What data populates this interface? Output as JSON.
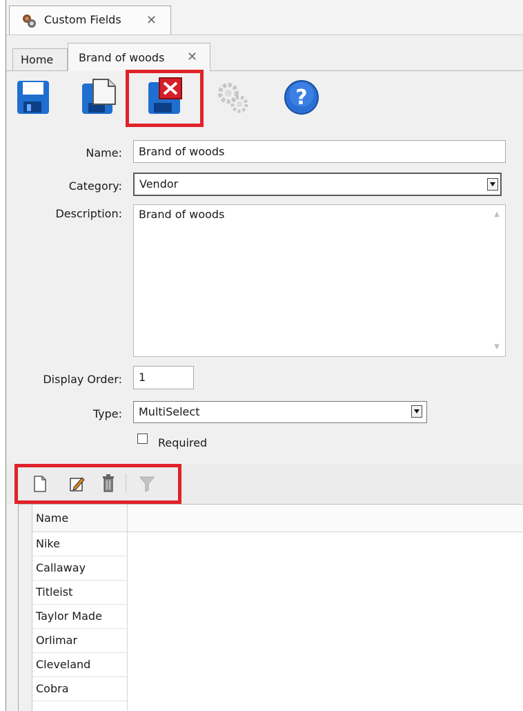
{
  "window_tab": {
    "title": "Custom Fields",
    "close_glyph": "✕",
    "icon": "custom-fields-app-icon"
  },
  "doc_tabs": [
    {
      "label": "Home",
      "selected": false
    },
    {
      "label": "Brand of woods",
      "selected": true,
      "close_glyph": "✕"
    }
  ],
  "toolbar": {
    "buttons": [
      {
        "name": "save-icon"
      },
      {
        "name": "save-as-icon"
      },
      {
        "name": "save-and-close-icon",
        "highlighted": true
      },
      {
        "name": "gears-icon",
        "disabled": true
      },
      {
        "name": "help-icon",
        "glyph": "?"
      }
    ]
  },
  "form": {
    "name_label": "Name:",
    "name_value": "Brand of woods",
    "category_label": "Category:",
    "category_value": "Vendor",
    "description_label": "Description:",
    "description_value": "Brand of woods",
    "display_order_label": "Display Order:",
    "display_order_value": "1",
    "type_label": "Type:",
    "type_value": "MultiSelect",
    "required_label": "Required",
    "required_checked": false
  },
  "grid_toolbar": {
    "buttons": [
      "new-icon",
      "edit-icon",
      "delete-icon",
      "filter-icon"
    ],
    "highlighted": true
  },
  "grid": {
    "header": "Name",
    "rows": [
      "Nike",
      "Callaway",
      "Titleist",
      "Taylor Made",
      "Orlimar",
      "Cleveland",
      "Cobra"
    ]
  },
  "colors": {
    "highlight": "#e0222a",
    "accent_blue": "#1f6fd0"
  }
}
